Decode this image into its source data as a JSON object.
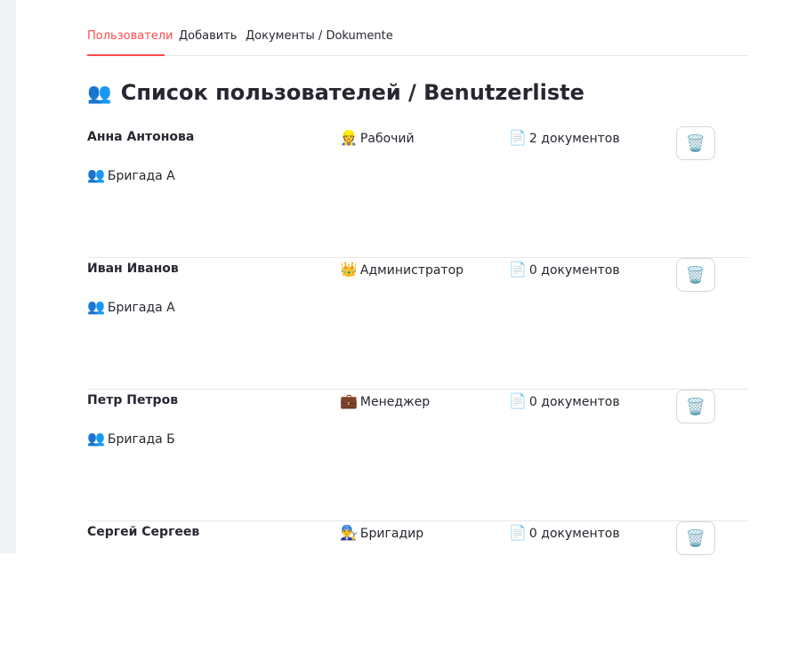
{
  "tabs": [
    {
      "label": "Пользователи",
      "active": true
    },
    {
      "label": "Добавить",
      "active": false
    },
    {
      "label": "Документы / Dokumente",
      "active": false
    }
  ],
  "page": {
    "title_icon": "👥",
    "title": "Список пользователей / Benutzerliste"
  },
  "users": [
    {
      "name": "Анна Антонова",
      "role_icon": "👷",
      "role": "Рабочий",
      "docs_icon": "📄",
      "docs": "2 документов",
      "team_icon": "👥",
      "team": "Бригада А",
      "delete_icon": "🗑️"
    },
    {
      "name": "Иван Иванов",
      "role_icon": "👑",
      "role": "Администратор",
      "docs_icon": "📄",
      "docs": "0 документов",
      "team_icon": "👥",
      "team": "Бригада А",
      "delete_icon": "🗑️"
    },
    {
      "name": "Петр Петров",
      "role_icon": "💼",
      "role": "Менеджер",
      "docs_icon": "📄",
      "docs": "0 документов",
      "team_icon": "👥",
      "team": "Бригада Б",
      "delete_icon": "🗑️"
    },
    {
      "name": "Сергей Сергеев",
      "role_icon": "👨‍🔧",
      "role": "Бригадир",
      "docs_icon": "📄",
      "docs": "0 документов",
      "team_icon": "",
      "team": "",
      "delete_icon": "🗑️"
    }
  ],
  "colors": {
    "accent": "#ff4b4b",
    "text": "#262730",
    "divider": "#e6e7eb",
    "sidebar_strip": "#f0f2f6"
  }
}
